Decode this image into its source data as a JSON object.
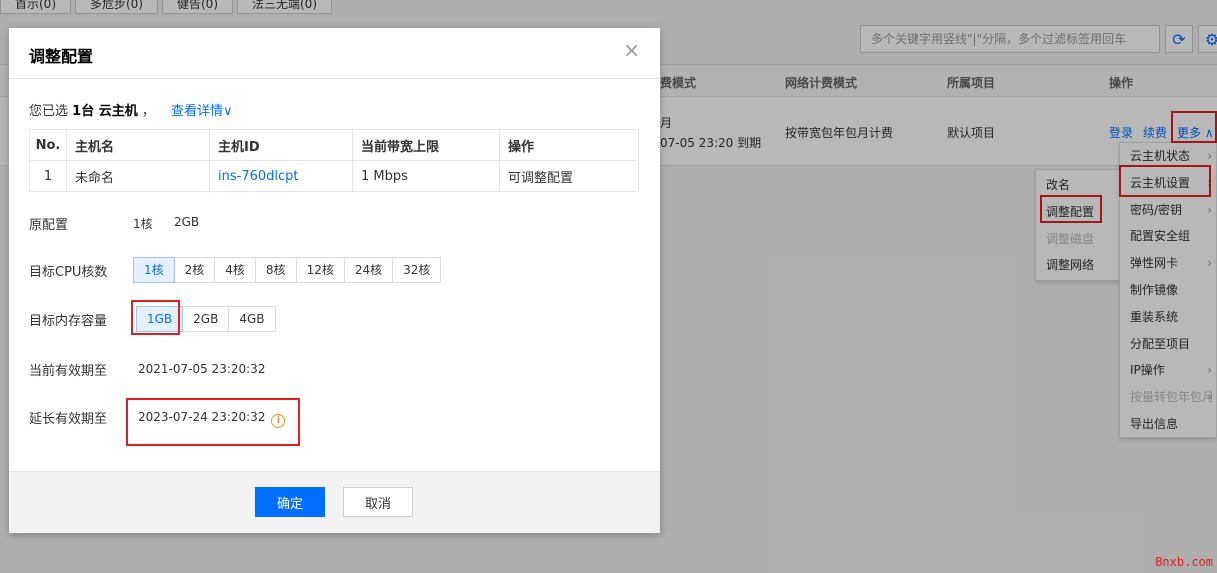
{
  "background": {
    "tabs": [
      "首示(0)",
      "多危步(0)",
      "健告(0)",
      "法三无端(0)"
    ],
    "search_placeholder": "多个关键字用竖线\"|\"分隔，多个过滤标签用回车",
    "table": {
      "headers": [
        "费模式",
        "网络计费模式",
        "所属项目",
        "操作"
      ],
      "row": {
        "billing_line1": "月",
        "billing_line2": "07-05 23:20 到期",
        "network_billing": "按带宽包年包月计费",
        "project": "默认项目",
        "op_login": "登录",
        "op_renew": "续费",
        "op_more": "更多"
      }
    },
    "more_menu": [
      "云主机状态",
      "云主机设置",
      "密码/密钥",
      "配置安全组",
      "弹性网卡",
      "制作镜像",
      "重装系统",
      "分配至项目",
      "IP操作",
      "按量转包年包月",
      "导出信息"
    ],
    "settings_submenu": [
      "改名",
      "调整配置",
      "调整磁盘",
      "调整网络"
    ]
  },
  "modal": {
    "title": "调整配置",
    "close": "×",
    "selected_prefix": "您已选",
    "selected_count": "1台 云主机",
    "selected_sep": "，",
    "view_details": "查看详情",
    "table": {
      "headers": [
        "No.",
        "主机名",
        "主机ID",
        "当前带宽上限",
        "操作"
      ],
      "rows": [
        {
          "no": "1",
          "name": "未命名",
          "id": "ins-760dlcpt",
          "bandwidth": "1 Mbps",
          "op": "可调整配置"
        }
      ]
    },
    "orig_config_label": "原配置",
    "orig_cpu": "1核",
    "orig_mem": "2GB",
    "cpu_label": "目标CPU核数",
    "cpu_options": [
      "1核",
      "2核",
      "4核",
      "8核",
      "12核",
      "24核",
      "32核"
    ],
    "mem_label": "目标内存容量",
    "mem_options": [
      "1GB",
      "2GB",
      "4GB"
    ],
    "expire_label": "当前有效期至",
    "expire_value": "2021-07-05 23:20:32",
    "extend_label": "延长有效期至",
    "extend_value": "2023-07-24 23:20:32",
    "confirm": "确定",
    "cancel": "取消"
  },
  "watermark": "Bnxb.com",
  "colors": {
    "primary": "#006eff",
    "highlight_box": "#e02020",
    "info": "#e8902a"
  }
}
